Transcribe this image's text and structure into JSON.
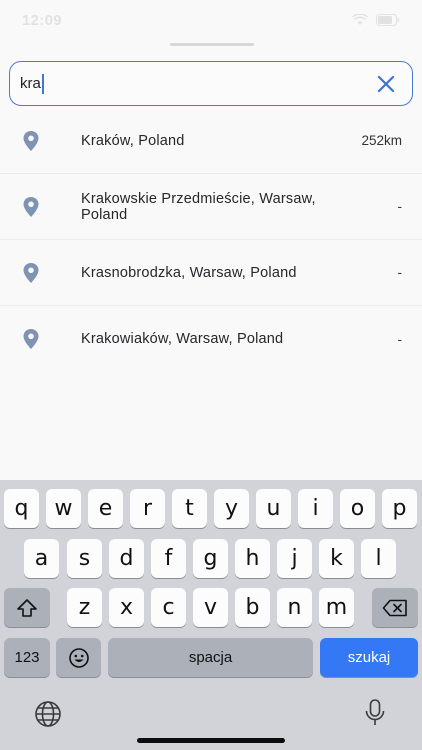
{
  "status_bar": {
    "time": "12:09"
  },
  "search": {
    "value": "kra",
    "clear_icon": "close-icon",
    "accent": "#4a7bd0"
  },
  "results": [
    {
      "label": "Kraków, Poland",
      "distance": "252km"
    },
    {
      "label": "Krakowskie Przedmieście, Warsaw, Poland",
      "distance": "-"
    },
    {
      "label": "Krasnobrodzka, Warsaw, Poland",
      "distance": "-"
    },
    {
      "label": "Krakowiaków, Warsaw, Poland",
      "distance": "-"
    }
  ],
  "colors": {
    "pin": "#7f93b2",
    "action_key": "#3478f6",
    "keyboard_bg": "#d1d3d9"
  },
  "keyboard": {
    "row1": [
      "q",
      "w",
      "e",
      "r",
      "t",
      "y",
      "u",
      "i",
      "o",
      "p"
    ],
    "row2": [
      "a",
      "s",
      "d",
      "f",
      "g",
      "h",
      "j",
      "k",
      "l"
    ],
    "row3": [
      "z",
      "x",
      "c",
      "v",
      "b",
      "n",
      "m"
    ],
    "numbers_label": "123",
    "space_label": "spacja",
    "action_label": "szukaj"
  }
}
